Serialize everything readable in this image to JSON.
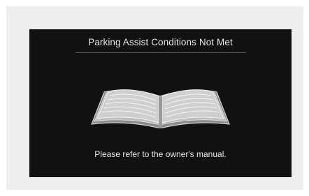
{
  "screen": {
    "title": "Parking Assist Conditions Not Met",
    "message": "Please refer to the owner's manual.",
    "icon": "open-book-icon"
  },
  "colors": {
    "background": "#111111",
    "text": "#e8e8e8",
    "outer_panel": "#eeeeee"
  }
}
